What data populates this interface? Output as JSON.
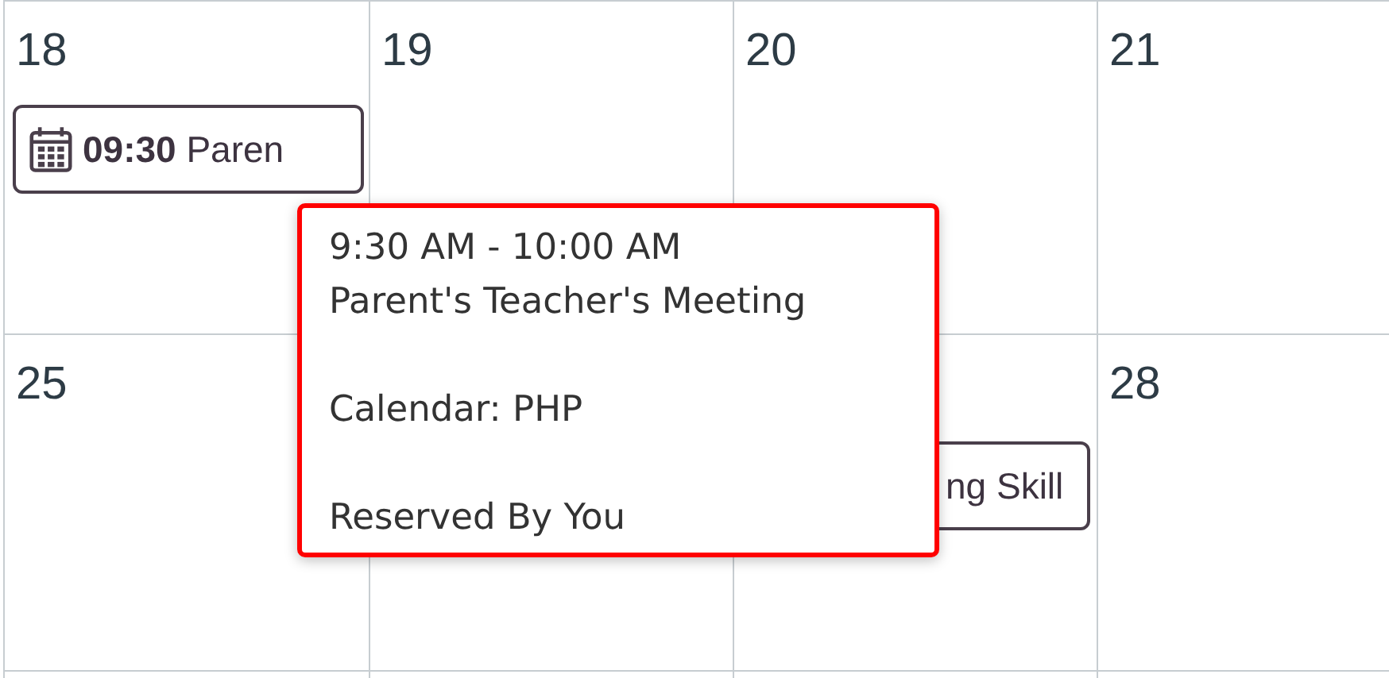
{
  "weeks": [
    {
      "days": [
        {
          "number": "18",
          "events": [
            {
              "kind": "appointment",
              "time": "09:30",
              "title": "Paren"
            }
          ]
        },
        {
          "number": "19"
        },
        {
          "number": "20"
        },
        {
          "number": "21"
        }
      ]
    },
    {
      "days": [
        {
          "number": "25"
        },
        {
          "tooltip": {
            "time_range": "9:30 AM - 10:00 AM",
            "title": "Parent's Teacher's Meeting",
            "calendar": "Calendar: PHP",
            "status": "Reserved By You"
          }
        },
        {
          "events": [
            {
              "kind": "plain",
              "title": "ng Skill"
            }
          ]
        },
        {
          "number": "28"
        }
      ]
    }
  ]
}
